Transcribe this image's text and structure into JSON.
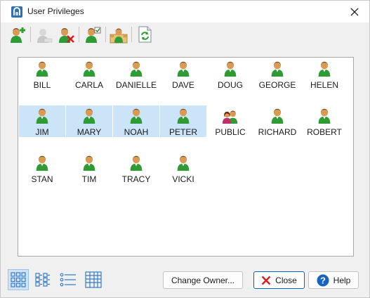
{
  "window": {
    "title": "User Privileges",
    "close_glyph": "✕"
  },
  "toolbar": {
    "buttons": [
      {
        "icon": "add-user-icon",
        "tooltip": "Add User",
        "enabled": true
      },
      {
        "icon": "edit-user-icon",
        "tooltip": "Edit User",
        "enabled": false
      },
      {
        "icon": "delete-user-icon",
        "tooltip": "Delete User",
        "enabled": true
      },
      {
        "icon": "user-privileges-icon",
        "tooltip": "Privileges",
        "enabled": true
      },
      {
        "icon": "group-users-icon",
        "tooltip": "Groups",
        "enabled": true
      },
      {
        "icon": "refresh-icon",
        "tooltip": "Refresh",
        "enabled": true
      }
    ]
  },
  "users": [
    {
      "name": "BILL",
      "type": "user",
      "selected": false
    },
    {
      "name": "CARLA",
      "type": "user",
      "selected": false
    },
    {
      "name": "DANIELLE",
      "type": "user",
      "selected": false
    },
    {
      "name": "DAVE",
      "type": "user",
      "selected": false
    },
    {
      "name": "DOUG",
      "type": "user",
      "selected": false
    },
    {
      "name": "GEORGE",
      "type": "user",
      "selected": false
    },
    {
      "name": "HELEN",
      "type": "user",
      "selected": false
    },
    {
      "name": "JIM",
      "type": "user",
      "selected": true
    },
    {
      "name": "MARY",
      "type": "user",
      "selected": true
    },
    {
      "name": "NOAH",
      "type": "user",
      "selected": true
    },
    {
      "name": "PETER",
      "type": "user",
      "selected": true
    },
    {
      "name": "PUBLIC",
      "type": "group",
      "selected": false
    },
    {
      "name": "RICHARD",
      "type": "user",
      "selected": false
    },
    {
      "name": "ROBERT",
      "type": "user",
      "selected": false
    },
    {
      "name": "STAN",
      "type": "user",
      "selected": false
    },
    {
      "name": "TIM",
      "type": "user",
      "selected": false
    },
    {
      "name": "TRACY",
      "type": "user",
      "selected": false
    },
    {
      "name": "VICKI",
      "type": "user",
      "selected": false
    }
  ],
  "view_modes": [
    {
      "icon": "large-icons-view-icon",
      "active": true
    },
    {
      "icon": "small-icons-view-icon",
      "active": false
    },
    {
      "icon": "list-view-icon",
      "active": false
    },
    {
      "icon": "details-view-icon",
      "active": false
    }
  ],
  "buttons": {
    "change_owner": "Change Owner...",
    "close": "Close",
    "help": "Help"
  },
  "colors": {
    "selection": "#cce4f7",
    "user_green": "#2e9b34",
    "skin": "#d99a52",
    "hair": "#7a4a1e",
    "close_red": "#d32020",
    "help_blue": "#1565c0"
  }
}
